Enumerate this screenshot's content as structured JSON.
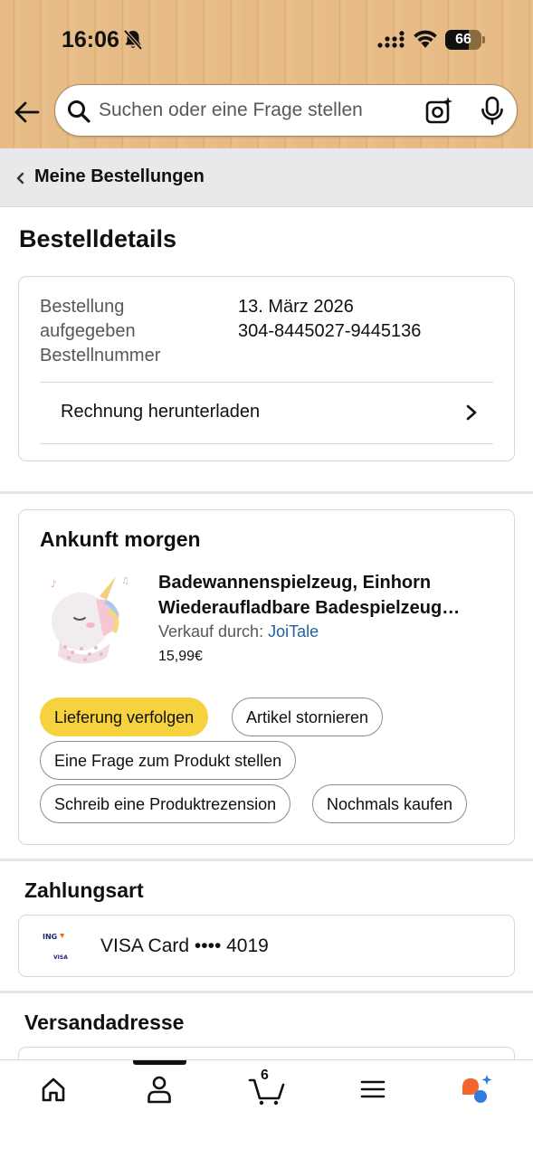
{
  "status_bar": {
    "time": "16:06",
    "battery": "66",
    "battery_level_percent": 66
  },
  "search": {
    "placeholder": "Suchen oder eine Frage stellen"
  },
  "breadcrumb": {
    "label": "Meine Bestellungen"
  },
  "page_title": "Bestelldetails",
  "order_info": {
    "label_line1": "Bestellung",
    "label_line2": "aufgegeben",
    "label_line3": "Bestellnummer",
    "order_date": "13. März 2026",
    "order_number": "304-8445027-9445136",
    "invoice_link": "Rechnung herunterladen"
  },
  "shipment": {
    "status_title": "Ankunft morgen",
    "product_title_line1": "Badewannenspielzeug, Einhorn",
    "product_title_line2": "Wiederaufladbare Badespielzeug…",
    "seller_prefix": "Verkauf durch: ",
    "seller_name": "JoiTale",
    "price": "15,99€",
    "actions": {
      "track": "Lieferung verfolgen",
      "cancel": "Artikel stornieren",
      "ask_question": "Eine Frage zum Produkt stellen",
      "write_review": "Schreib eine Produktrezension",
      "buy_again": "Nochmals kaufen"
    }
  },
  "payment": {
    "heading": "Zahlungsart",
    "card_text": "VISA Card •••• 4019",
    "bank_logo_text": "ING",
    "card_brand_text": "VISA"
  },
  "shipping": {
    "heading": "Versandadresse"
  },
  "bottom_nav": {
    "cart_count": "6",
    "icons": [
      "home-icon",
      "account-icon",
      "cart-icon",
      "menu-icon",
      "rufus-icon"
    ],
    "accent_orange": "#f2652c",
    "accent_blue": "#2f7de1"
  },
  "colors": {
    "primary_button": "#f5d23e",
    "link": "#2162a1",
    "header_bg": "#e7bb85"
  }
}
